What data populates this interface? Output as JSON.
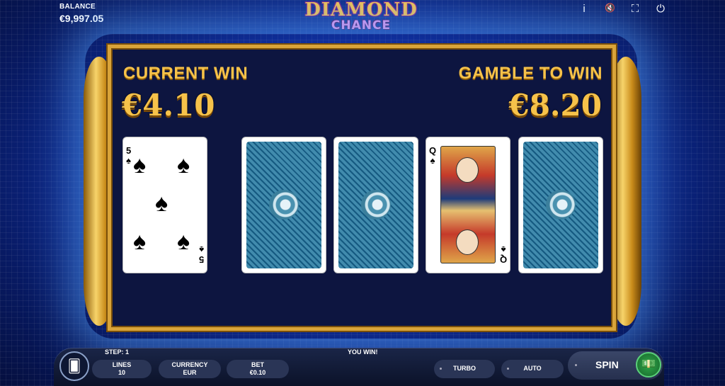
{
  "header": {
    "balance_label": "BALANCE",
    "balance_value": "€9,997.05",
    "logo_line1": "DIAMOND",
    "logo_line2": "CHANCE",
    "icons": [
      "info-icon",
      "mute-icon",
      "fullscreen-icon",
      "power-icon"
    ],
    "icon_glyphs": {
      "info": "i",
      "mute": "🔇",
      "fullscreen": "⛶",
      "power": "⏻"
    }
  },
  "gamble": {
    "current_win_label": "CURRENT WIN",
    "current_win_value": "€4.10",
    "gamble_label": "GAMBLE TO WIN",
    "gamble_value": "€8.20"
  },
  "cards": [
    {
      "state": "face-up",
      "rank": "5",
      "suit": "♠"
    },
    {
      "state": "face-down"
    },
    {
      "state": "face-down"
    },
    {
      "state": "face-up",
      "rank": "Q",
      "suit": "♠"
    },
    {
      "state": "face-down"
    }
  ],
  "bottom_bar": {
    "step": "STEP: 1",
    "message": "YOU WIN!",
    "lines_label": "LINES",
    "lines_value": "10",
    "currency_label": "CURRENCY",
    "currency_value": "EUR",
    "bet_label": "BET",
    "bet_value": "€0.10",
    "turbo_label": "TURBO",
    "auto_label": "AUTO",
    "spin_label": "SPIN"
  },
  "colors": {
    "gold": "#f6c24a",
    "panel": "#0d1540",
    "background": "#0f2e9a",
    "spin_icon": "#2fa84a"
  }
}
